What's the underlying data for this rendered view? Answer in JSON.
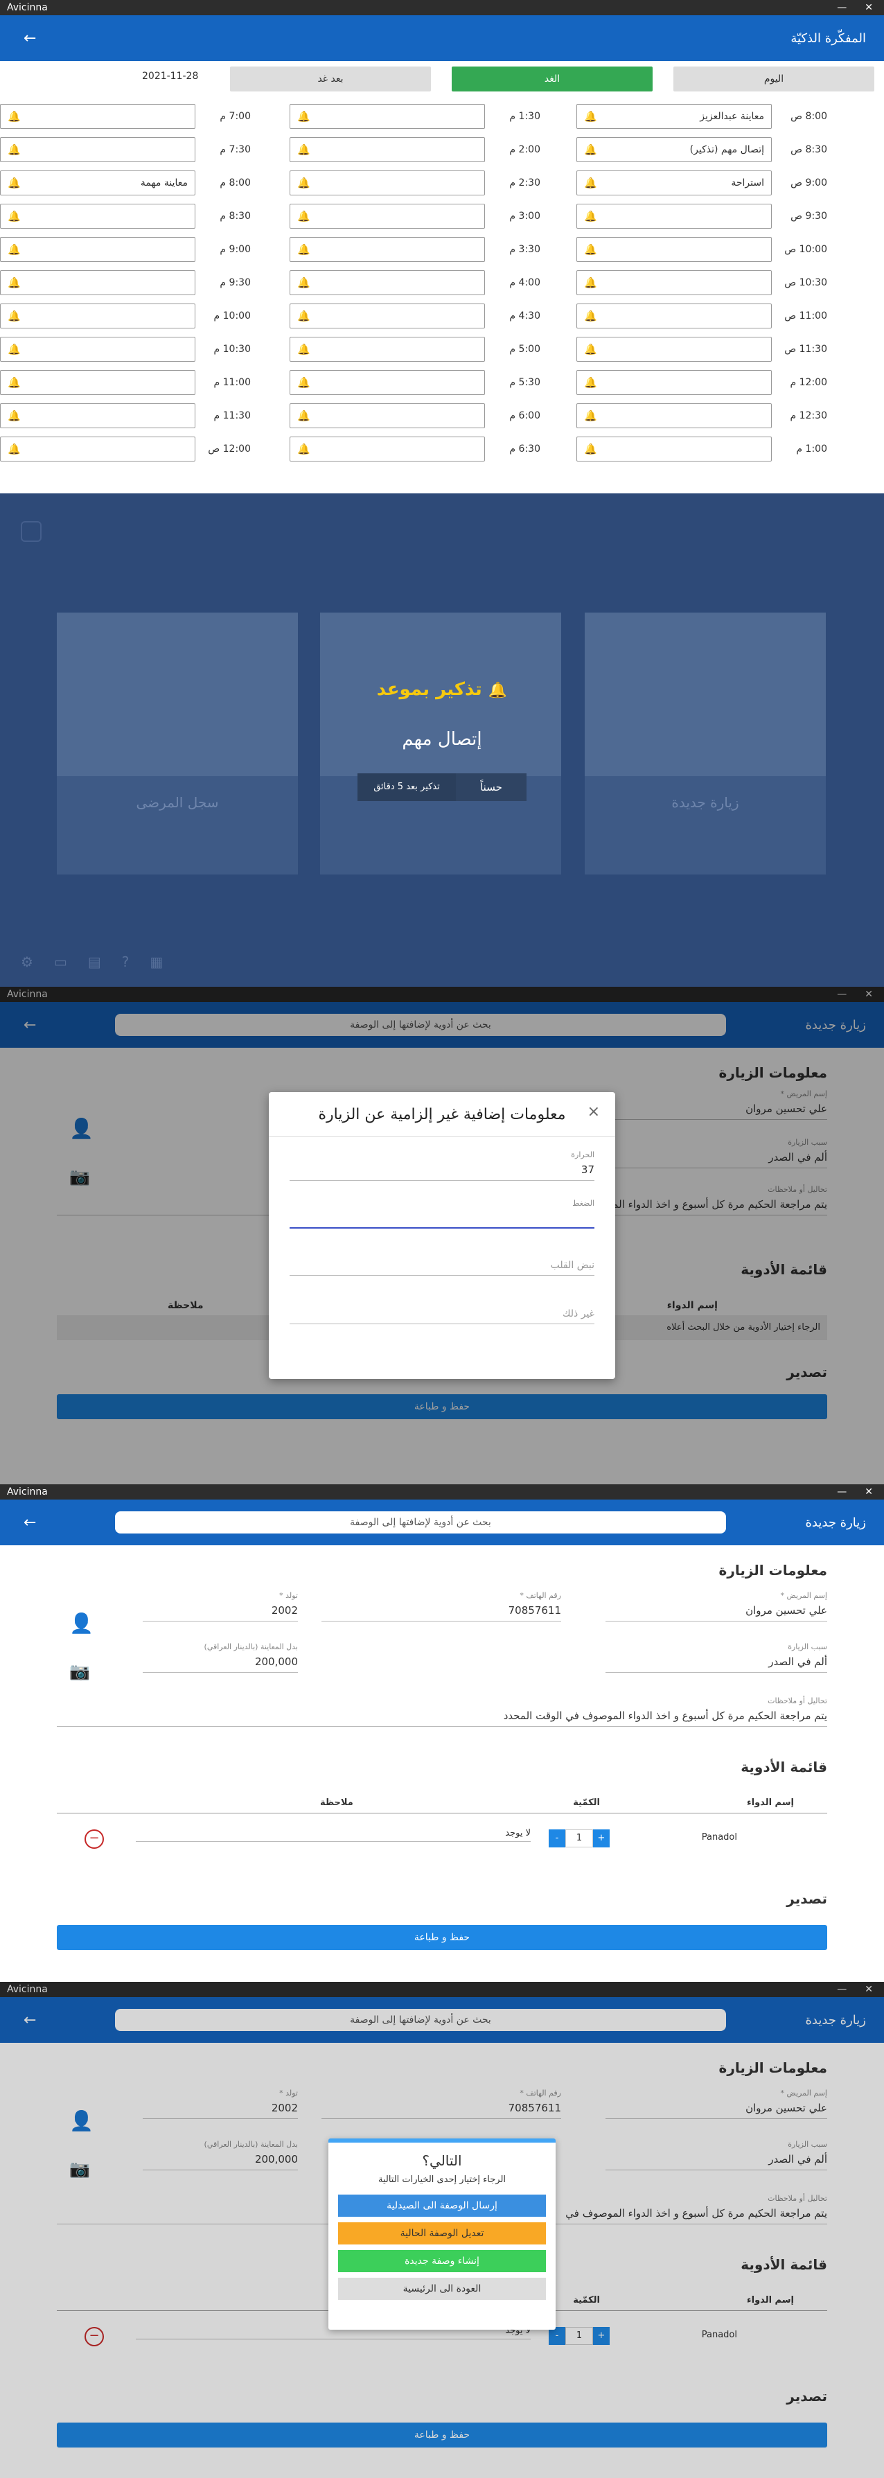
{
  "app_name": "Avicinna",
  "window_controls": {
    "minimize": "—",
    "close": "✕"
  },
  "planner": {
    "title": "المفكّرة الذكيّة",
    "back": "←",
    "days": {
      "today": "اليوم",
      "tomorrow": "الغد",
      "after": "بعد غد"
    },
    "date": "2021-11-28",
    "col1": [
      {
        "time": "8:00 ص",
        "text": "معاينة عبدالعزيز",
        "alert": true
      },
      {
        "time": "8:30 ص",
        "text": "إتصال مهم (تذكير)",
        "alert": true
      },
      {
        "time": "9:00 ص",
        "text": "استراحة",
        "alert": false
      },
      {
        "time": "9:30 ص",
        "text": "",
        "alert": false
      },
      {
        "time": "10:00 ص",
        "text": "",
        "alert": false
      },
      {
        "time": "10:30 ص",
        "text": "",
        "alert": false
      },
      {
        "time": "11:00 ص",
        "text": "",
        "alert": false
      },
      {
        "time": "11:30 ص",
        "text": "",
        "alert": false
      },
      {
        "time": "12:00 م",
        "text": "",
        "alert": false
      },
      {
        "time": "12:30 م",
        "text": "",
        "alert": false
      },
      {
        "time": "1:00 م",
        "text": "",
        "alert": false
      }
    ],
    "col2": [
      {
        "time": "1:30 م",
        "text": "",
        "alert": false
      },
      {
        "time": "2:00 م",
        "text": "",
        "alert": false
      },
      {
        "time": "2:30 م",
        "text": "",
        "alert": false
      },
      {
        "time": "3:00 م",
        "text": "",
        "alert": false
      },
      {
        "time": "3:30 م",
        "text": "",
        "alert": false
      },
      {
        "time": "4:00 م",
        "text": "",
        "alert": false
      },
      {
        "time": "4:30 م",
        "text": "",
        "alert": false
      },
      {
        "time": "5:00 م",
        "text": "",
        "alert": false
      },
      {
        "time": "5:30 م",
        "text": "",
        "alert": false
      },
      {
        "time": "6:00 م",
        "text": "",
        "alert": false
      },
      {
        "time": "6:30 م",
        "text": "",
        "alert": false
      }
    ],
    "col3": [
      {
        "time": "7:00 م",
        "text": "",
        "alert": false
      },
      {
        "time": "7:30 م",
        "text": "",
        "alert": false
      },
      {
        "time": "8:00 م",
        "text": "معاينة مهمة",
        "alert": true
      },
      {
        "time": "8:30 م",
        "text": "",
        "alert": false
      },
      {
        "time": "9:00 م",
        "text": "",
        "alert": false
      },
      {
        "time": "9:30 م",
        "text": "",
        "alert": false
      },
      {
        "time": "10:00 م",
        "text": "",
        "alert": false
      },
      {
        "time": "10:30 م",
        "text": "",
        "alert": false
      },
      {
        "time": "11:00 م",
        "text": "",
        "alert": false
      },
      {
        "time": "11:30 م",
        "text": "",
        "alert": false
      },
      {
        "time": "12:00 ص",
        "text": "",
        "alert": false
      }
    ]
  },
  "reminder": {
    "title": "تذكير بموعد",
    "message": "إتصال مهم",
    "ok": "حسناً",
    "snooze": "تذكير بعد 5 دقائق",
    "cards": [
      "سجل المرضى",
      "",
      "زيارة جديدة"
    ]
  },
  "visit": {
    "title": "زيارة جديدة",
    "back": "←",
    "search_placeholder": "بحث عن أدوية لإضافتها إلى الوصفة",
    "section_info": "معلومات الزيارة",
    "patient_label": "إسم المريض *",
    "patient": "علي تحسين مروان",
    "phone_label": "رقم الهاتف *",
    "phone": "70857611",
    "birth_label": "تولد *",
    "birth": "2002",
    "reason_label": "سبب الزيارة",
    "reason": "ألم في الصدر",
    "fee_label": "بدل المعاينة (بالدينار العراقي)",
    "fee": "200,000",
    "notes_label": "تحاليل أو ملاحظات",
    "notes": "يتم مراجعة الحكيم مرة كل أسبوع و اخذ الدواء الموصوف في الوقت المحدد",
    "notes_short": "يتم مراجعة الحكيم مرة كل أسبوع و اخذ الدواء الموصوف في",
    "section_meds": "قائمة الأدوية",
    "col_drug": "إسم الدواء",
    "col_qty": "الكمّية",
    "col_note": "ملاحظة",
    "empty_hint": "الرجاء إختيار الأدوية من خلال البحث أعلاه",
    "drug": "Panadol",
    "qty": "1",
    "drug_note": "لا يوجد",
    "section_export": "تصدير",
    "save": "حفظ و طباعة"
  },
  "extra_modal": {
    "title": "معلومات إضافية غير إلزامية عن الزيارة",
    "close": "×",
    "temp_label": "الحرارة",
    "temp": "37",
    "pressure_label": "الضغط",
    "pulse": "نبض القلب",
    "other": "غير ذلك"
  },
  "next_modal": {
    "title": "التالي؟",
    "subtitle": "الرجاء إختيار إحدى الخيارات التالية",
    "btn1": "إرسال الوصفة الى الصيدلية",
    "btn2": "تعديل الوصفة الحالية",
    "btn3": "إنشاء وصفة جديدة",
    "btn4": "العودة الى الرئيسية"
  },
  "colors": {
    "primary": "#1565c0",
    "green": "#34a853",
    "yellow": "#f9a825",
    "blue": "#1e88e5",
    "alert_bell": "#cc0000",
    "gold": "#f6c90e"
  }
}
